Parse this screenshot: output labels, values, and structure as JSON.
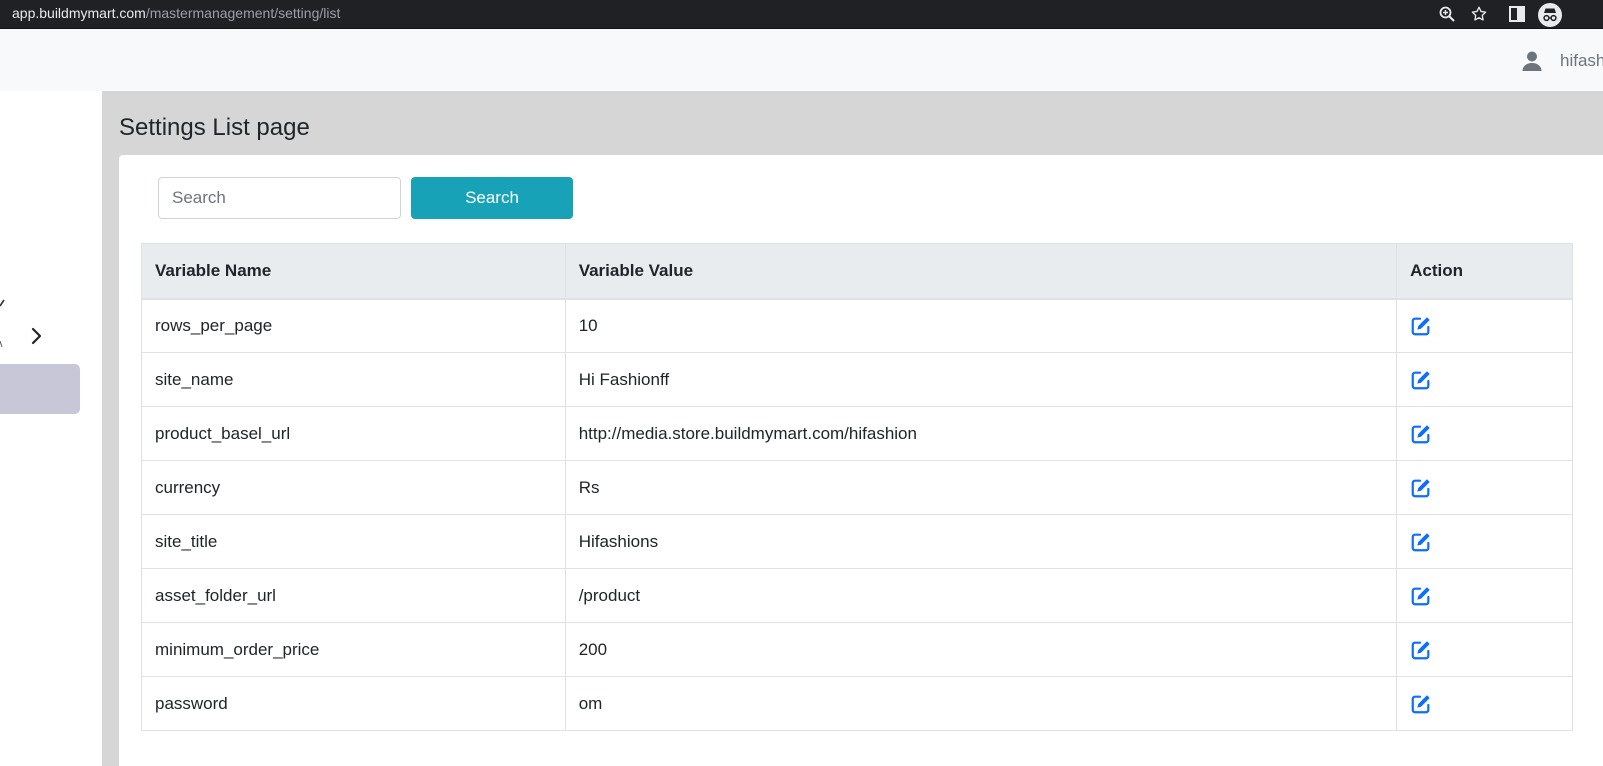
{
  "browser": {
    "url_host": "app.buildmymart.com",
    "url_path": "/mastermanagement/setting/list",
    "icons": [
      "zoom-icon",
      "bookmark-star-icon",
      "side-panel-icon",
      "incognito-icon"
    ]
  },
  "header": {
    "user_name": "hifash",
    "user_icon": "user-icon"
  },
  "sidebar": {
    "icons": [
      "chevron-right-icon"
    ],
    "active_item_color": "#c8c7d7"
  },
  "main": {
    "page_title": "Settings List page",
    "search": {
      "placeholder": "Search",
      "value": "",
      "button_label": "Search"
    },
    "table": {
      "headers": [
        "Variable Name",
        "Variable Value",
        "Action"
      ],
      "rows": [
        {
          "name": "rows_per_page",
          "value": "10"
        },
        {
          "name": "site_name",
          "value": "Hi Fashionff"
        },
        {
          "name": "product_basel_url",
          "value": "http://media.store.buildmymart.com/hifashion"
        },
        {
          "name": "currency",
          "value": "Rs"
        },
        {
          "name": "site_title",
          "value": "Hifashions"
        },
        {
          "name": "asset_folder_url",
          "value": "/product"
        },
        {
          "name": "minimum_order_price",
          "value": "200"
        },
        {
          "name": "password",
          "value": "om"
        }
      ],
      "action_icon": "edit-icon"
    }
  },
  "colors": {
    "accent": "#17a2b8",
    "edit_icon": "#0d6efd",
    "header_bg": "#e9ecef",
    "main_bg": "#d6d6d6"
  }
}
